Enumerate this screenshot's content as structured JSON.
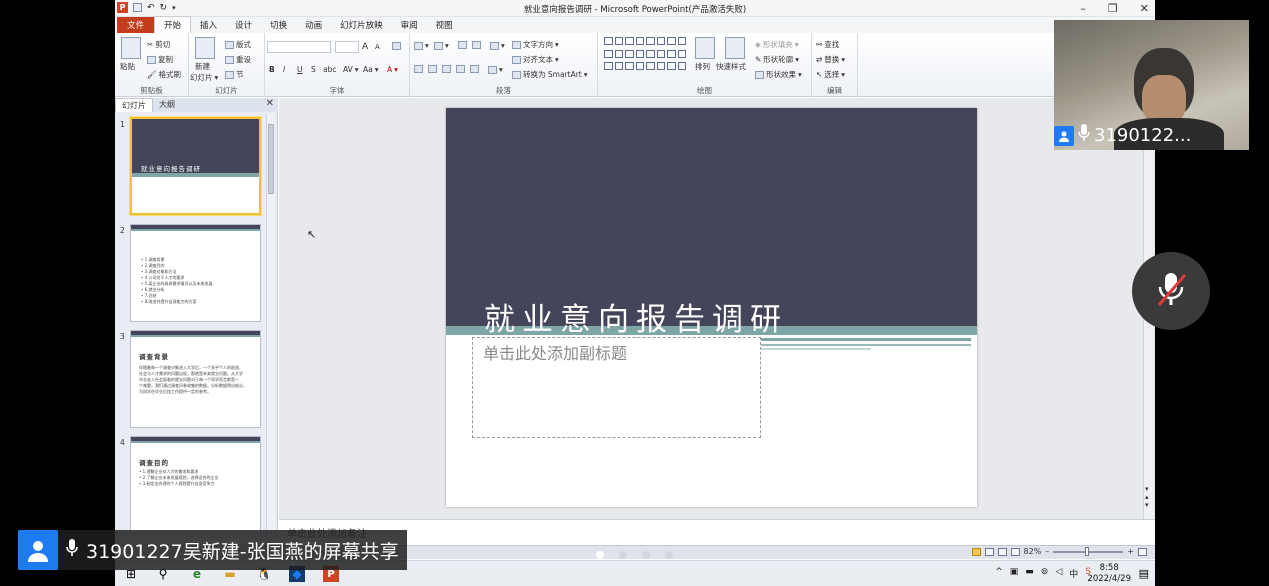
{
  "titlebar": {
    "title": "就业意向报告调研 - Microsoft PowerPoint(产品激活失败)",
    "app_logo": "P",
    "minimize": "–",
    "maximize": "❐",
    "close": "✕"
  },
  "tabs": [
    {
      "label": "文件"
    },
    {
      "label": "开始"
    },
    {
      "label": "插入"
    },
    {
      "label": "设计"
    },
    {
      "label": "切换"
    },
    {
      "label": "动画"
    },
    {
      "label": "幻灯片放映"
    },
    {
      "label": "审阅"
    },
    {
      "label": "视图"
    }
  ],
  "ribbon": {
    "clipboard": {
      "paste": "粘贴",
      "cut": "剪切",
      "copy": "复制",
      "format_painter": "格式刷",
      "label": "剪贴板"
    },
    "slides": {
      "new_slide": "新建",
      "new_slide2": "幻灯片",
      "layout": "版式",
      "reset": "重设",
      "section": "节",
      "label": "幻灯片"
    },
    "font": {
      "label": "字体",
      "bold": "B",
      "italic": "I",
      "underline": "U",
      "strike": "S",
      "abc": "abc",
      "av": "AV",
      "aa": "Aa",
      "a": "A",
      "grow": "A",
      "shrink": "A"
    },
    "paragraph": {
      "text_direction": "文字方向",
      "align_text": "对齐文本",
      "smartart": "转换为 SmartArt",
      "label": "段落"
    },
    "drawing": {
      "arrange": "排列",
      "quick_styles": "快速样式",
      "shape_fill": "形状填充",
      "shape_outline": "形状轮廓",
      "shape_effects": "形状效果",
      "label": "绘图"
    },
    "editing": {
      "find": "查找",
      "replace": "替换",
      "select": "选择",
      "label": "编辑"
    }
  },
  "pane": {
    "tab_slides": "幻灯片",
    "tab_outline": "大纲",
    "close": "✕",
    "thumbs": [
      {
        "num": "1",
        "title": "就业意向报告调研"
      },
      {
        "num": "2",
        "lines": [
          "• 1.调查背景",
          "• 2.调查目的",
          "• 3.调查对象和方法",
          "• 4.公司对于人才的要求",
          "• 5.某企业的具体需求情况以及未来发展",
          "• 6.就业分析",
          "• 7.总结",
          "• 8.改进并提升自身能力的方案"
        ]
      },
      {
        "num": "3",
        "title": "调查背景",
        "lines": [
          "伴随着每一个调查对象进入大学后，一个关乎个人的前途、",
          "社会与人才需求的问题出现，那就是未来就业问题。从大学",
          "毕业走入社会面临的就业问题对于每一个同学而言都是一",
          "个难题，我们通过调查问卷收集的数据，分析数据得出结论，",
          "为同学在毕业后找工作提供一定的参考。"
        ]
      },
      {
        "num": "4",
        "title": "调查目的",
        "lines": [
          "• 1.理解企业对人才的需求和要求",
          "• 2.了解企业未来发展规划，选择适合的企业",
          "• 3.制定出合理的个人规划提升自身竞争力"
        ]
      }
    ]
  },
  "slide": {
    "title": "就业意向报告调研",
    "subtitle_placeholder": "单击此处添加副标题"
  },
  "notes": {
    "placeholder": "单击此处添加备注"
  },
  "statusbar": {
    "zoom": "82%",
    "minus": "–",
    "plus": "+"
  },
  "taskbar": {
    "start": "⊞",
    "search": "⚲",
    "edge": "e",
    "explorer": "▬",
    "qq": "🐧",
    "meeting": "◆",
    "ppt": "P",
    "tray": [
      "^",
      "▣",
      "▬",
      "⊚",
      "◁",
      "中",
      "S"
    ],
    "time": "8:58",
    "date": "2022/4/29",
    "notification": "▤"
  },
  "overlay": {
    "camera_user": "3190122...",
    "share_label": "31901227吴新建-张国燕的屏幕共享"
  },
  "colors": {
    "slide_dark": "#44445a",
    "slide_teal": "#7ea6a6",
    "file_tab": "#c33c1c",
    "selected_thumb": "#f0c233",
    "user_badge": "#1f7bf2"
  }
}
